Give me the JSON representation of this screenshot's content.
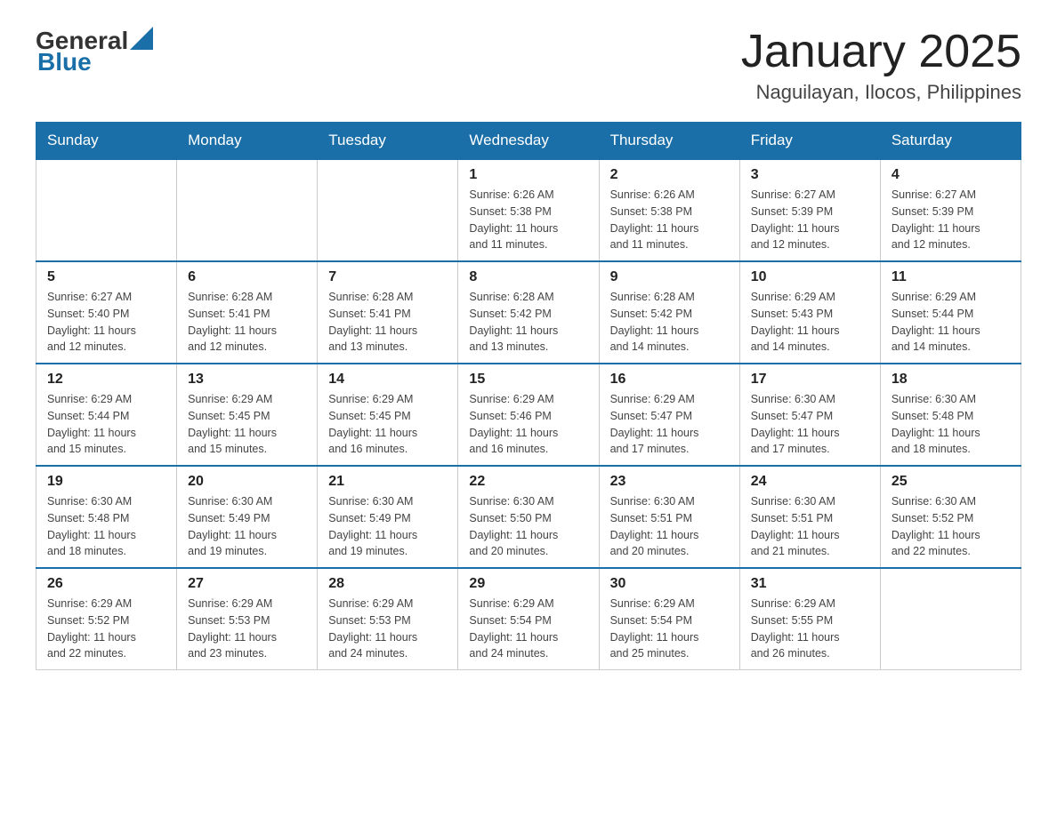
{
  "header": {
    "logo": {
      "text_general": "General",
      "text_blue": "Blue",
      "alt": "GeneralBlue logo"
    },
    "title": "January 2025",
    "location": "Naguilayan, Ilocos, Philippines"
  },
  "days_of_week": [
    "Sunday",
    "Monday",
    "Tuesday",
    "Wednesday",
    "Thursday",
    "Friday",
    "Saturday"
  ],
  "weeks": [
    {
      "days": [
        {
          "number": "",
          "info": ""
        },
        {
          "number": "",
          "info": ""
        },
        {
          "number": "",
          "info": ""
        },
        {
          "number": "1",
          "info": "Sunrise: 6:26 AM\nSunset: 5:38 PM\nDaylight: 11 hours\nand 11 minutes."
        },
        {
          "number": "2",
          "info": "Sunrise: 6:26 AM\nSunset: 5:38 PM\nDaylight: 11 hours\nand 11 minutes."
        },
        {
          "number": "3",
          "info": "Sunrise: 6:27 AM\nSunset: 5:39 PM\nDaylight: 11 hours\nand 12 minutes."
        },
        {
          "number": "4",
          "info": "Sunrise: 6:27 AM\nSunset: 5:39 PM\nDaylight: 11 hours\nand 12 minutes."
        }
      ]
    },
    {
      "days": [
        {
          "number": "5",
          "info": "Sunrise: 6:27 AM\nSunset: 5:40 PM\nDaylight: 11 hours\nand 12 minutes."
        },
        {
          "number": "6",
          "info": "Sunrise: 6:28 AM\nSunset: 5:41 PM\nDaylight: 11 hours\nand 12 minutes."
        },
        {
          "number": "7",
          "info": "Sunrise: 6:28 AM\nSunset: 5:41 PM\nDaylight: 11 hours\nand 13 minutes."
        },
        {
          "number": "8",
          "info": "Sunrise: 6:28 AM\nSunset: 5:42 PM\nDaylight: 11 hours\nand 13 minutes."
        },
        {
          "number": "9",
          "info": "Sunrise: 6:28 AM\nSunset: 5:42 PM\nDaylight: 11 hours\nand 14 minutes."
        },
        {
          "number": "10",
          "info": "Sunrise: 6:29 AM\nSunset: 5:43 PM\nDaylight: 11 hours\nand 14 minutes."
        },
        {
          "number": "11",
          "info": "Sunrise: 6:29 AM\nSunset: 5:44 PM\nDaylight: 11 hours\nand 14 minutes."
        }
      ]
    },
    {
      "days": [
        {
          "number": "12",
          "info": "Sunrise: 6:29 AM\nSunset: 5:44 PM\nDaylight: 11 hours\nand 15 minutes."
        },
        {
          "number": "13",
          "info": "Sunrise: 6:29 AM\nSunset: 5:45 PM\nDaylight: 11 hours\nand 15 minutes."
        },
        {
          "number": "14",
          "info": "Sunrise: 6:29 AM\nSunset: 5:45 PM\nDaylight: 11 hours\nand 16 minutes."
        },
        {
          "number": "15",
          "info": "Sunrise: 6:29 AM\nSunset: 5:46 PM\nDaylight: 11 hours\nand 16 minutes."
        },
        {
          "number": "16",
          "info": "Sunrise: 6:29 AM\nSunset: 5:47 PM\nDaylight: 11 hours\nand 17 minutes."
        },
        {
          "number": "17",
          "info": "Sunrise: 6:30 AM\nSunset: 5:47 PM\nDaylight: 11 hours\nand 17 minutes."
        },
        {
          "number": "18",
          "info": "Sunrise: 6:30 AM\nSunset: 5:48 PM\nDaylight: 11 hours\nand 18 minutes."
        }
      ]
    },
    {
      "days": [
        {
          "number": "19",
          "info": "Sunrise: 6:30 AM\nSunset: 5:48 PM\nDaylight: 11 hours\nand 18 minutes."
        },
        {
          "number": "20",
          "info": "Sunrise: 6:30 AM\nSunset: 5:49 PM\nDaylight: 11 hours\nand 19 minutes."
        },
        {
          "number": "21",
          "info": "Sunrise: 6:30 AM\nSunset: 5:49 PM\nDaylight: 11 hours\nand 19 minutes."
        },
        {
          "number": "22",
          "info": "Sunrise: 6:30 AM\nSunset: 5:50 PM\nDaylight: 11 hours\nand 20 minutes."
        },
        {
          "number": "23",
          "info": "Sunrise: 6:30 AM\nSunset: 5:51 PM\nDaylight: 11 hours\nand 20 minutes."
        },
        {
          "number": "24",
          "info": "Sunrise: 6:30 AM\nSunset: 5:51 PM\nDaylight: 11 hours\nand 21 minutes."
        },
        {
          "number": "25",
          "info": "Sunrise: 6:30 AM\nSunset: 5:52 PM\nDaylight: 11 hours\nand 22 minutes."
        }
      ]
    },
    {
      "days": [
        {
          "number": "26",
          "info": "Sunrise: 6:29 AM\nSunset: 5:52 PM\nDaylight: 11 hours\nand 22 minutes."
        },
        {
          "number": "27",
          "info": "Sunrise: 6:29 AM\nSunset: 5:53 PM\nDaylight: 11 hours\nand 23 minutes."
        },
        {
          "number": "28",
          "info": "Sunrise: 6:29 AM\nSunset: 5:53 PM\nDaylight: 11 hours\nand 24 minutes."
        },
        {
          "number": "29",
          "info": "Sunrise: 6:29 AM\nSunset: 5:54 PM\nDaylight: 11 hours\nand 24 minutes."
        },
        {
          "number": "30",
          "info": "Sunrise: 6:29 AM\nSunset: 5:54 PM\nDaylight: 11 hours\nand 25 minutes."
        },
        {
          "number": "31",
          "info": "Sunrise: 6:29 AM\nSunset: 5:55 PM\nDaylight: 11 hours\nand 26 minutes."
        },
        {
          "number": "",
          "info": ""
        }
      ]
    }
  ]
}
